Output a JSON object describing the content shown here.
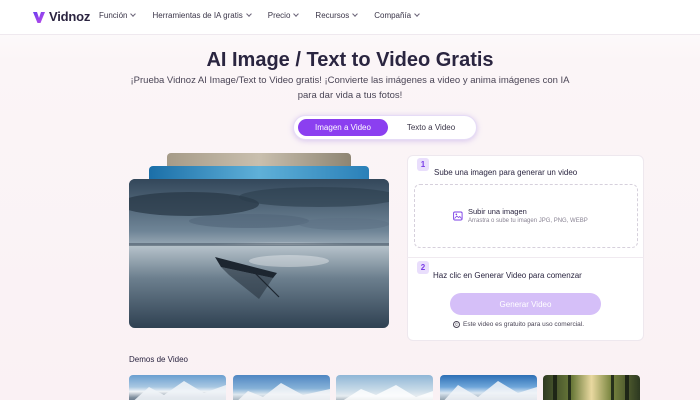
{
  "brand": {
    "name": "Vidnoz",
    "color": "#8b3ff0"
  },
  "nav": {
    "items": [
      {
        "label": "Función"
      },
      {
        "label": "Herramientas de IA gratis"
      },
      {
        "label": "Precio"
      },
      {
        "label": "Recursos"
      },
      {
        "label": "Compañía"
      }
    ]
  },
  "hero": {
    "title": "AI Image / Text to Video Gratis",
    "subtitle": "¡Prueba Vidnoz AI Image/Text to Video gratis! ¡Convierte las imágenes a video y anima imágenes con IA para dar vida a tus fotos!"
  },
  "tabs": {
    "active": "Imagen a Video",
    "inactive": "Texto a Video"
  },
  "steps": {
    "step1": {
      "number": "1",
      "label": "Sube una imagen para generar un video"
    },
    "upload": {
      "title": "Subir una imagen",
      "hint": "Arrastra o sube tu imagen JPG, PNG, WEBP",
      "icon": "image-upload-icon"
    },
    "step2": {
      "number": "2",
      "label": "Haz clic en Generar Video para comenzar"
    },
    "generate_label": "Generar Video",
    "free_note": "Este video es gratuito para uso comercial."
  },
  "demos": {
    "label": "Demos de Video"
  }
}
